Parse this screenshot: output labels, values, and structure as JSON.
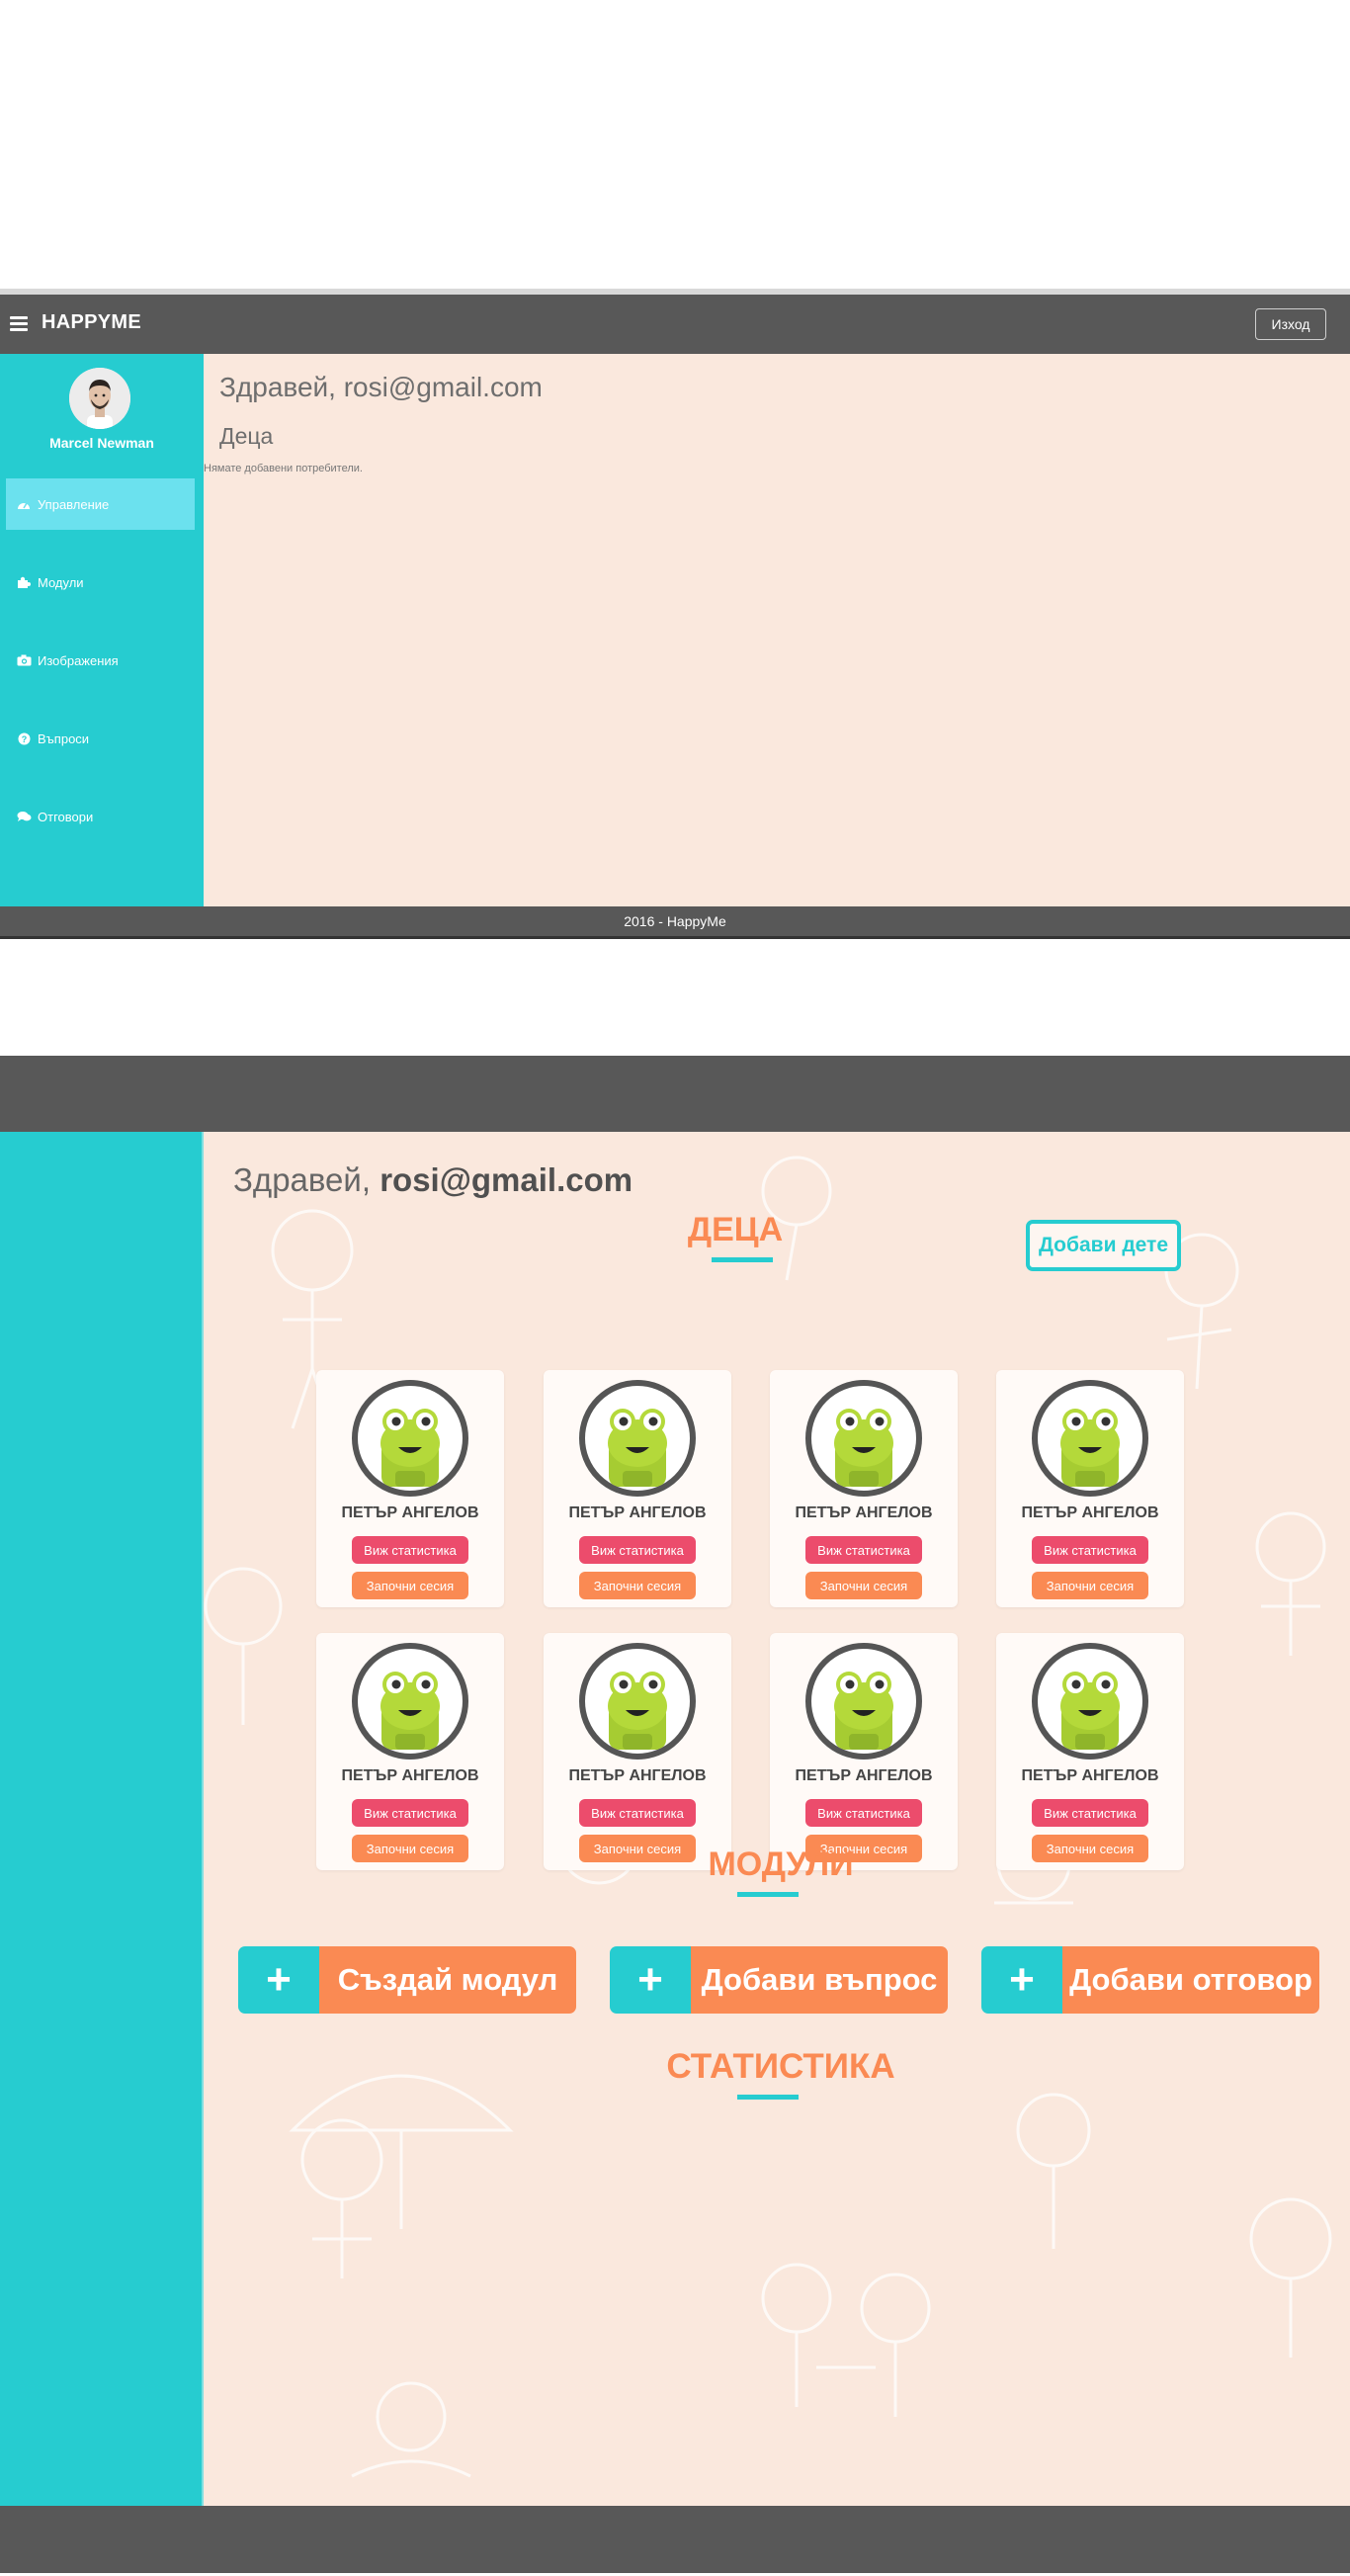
{
  "screen1": {
    "brand": "HAPPYME",
    "logout_label": "Изход",
    "user": {
      "name": "Marcel Newman"
    },
    "nav": [
      {
        "label": "Управление",
        "icon": "dashboard-icon",
        "active": true
      },
      {
        "label": "Модули",
        "icon": "puzzle-icon",
        "active": false
      },
      {
        "label": "Изображения",
        "icon": "camera-icon",
        "active": false
      },
      {
        "label": "Въпроси",
        "icon": "question-icon",
        "active": false
      },
      {
        "label": "Отговори",
        "icon": "comments-icon",
        "active": false
      }
    ],
    "greeting": "Здравей, rosi@gmail.com",
    "kids_title": "Деца",
    "empty_message": "Нямате добавени потребители.",
    "footer": "2016 - HappyMe"
  },
  "screen2": {
    "greeting_prefix": "Здравей, ",
    "greeting_email": "rosi@gmail.com",
    "kids_section_title": "ДЕЦА",
    "add_kid_label": "Добави дете",
    "kids": [
      {
        "name": "ПЕТЪР АНГЕЛОВ",
        "stats_label": "Виж статистика",
        "session_label": "Започни сесия"
      },
      {
        "name": "ПЕТЪР АНГЕЛОВ",
        "stats_label": "Виж статистика",
        "session_label": "Започни сесия"
      },
      {
        "name": "ПЕТЪР АНГЕЛОВ",
        "stats_label": "Виж статистика",
        "session_label": "Започни сесия"
      },
      {
        "name": "ПЕТЪР АНГЕЛОВ",
        "stats_label": "Виж статистика",
        "session_label": "Започни сесия"
      },
      {
        "name": "ПЕТЪР АНГЕЛОВ",
        "stats_label": "Виж статистика",
        "session_label": "Започни сесия"
      },
      {
        "name": "ПЕТЪР АНГЕЛОВ",
        "stats_label": "Виж статистика",
        "session_label": "Започни сесия"
      },
      {
        "name": "ПЕТЪР АНГЕЛОВ",
        "stats_label": "Виж статистика",
        "session_label": "Започни сесия"
      },
      {
        "name": "ПЕТЪР АНГЕЛОВ",
        "stats_label": "Виж статистика",
        "session_label": "Започни сесия"
      }
    ],
    "modules_section_title": "МОДУЛИ",
    "module_buttons": [
      {
        "label": "Създай модул",
        "icon": "plus-icon"
      },
      {
        "label": "Добави въпрос",
        "icon": "plus-icon"
      },
      {
        "label": "Добави отговор",
        "icon": "plus-icon"
      }
    ],
    "stats_section_title": "СТАТИСТИКА"
  },
  "colors": {
    "teal": "#26ccd0",
    "orange": "#fa8a53",
    "pink": "#ec4c6c",
    "header_gray": "#585858",
    "peach_bg": "#fae8dd"
  }
}
